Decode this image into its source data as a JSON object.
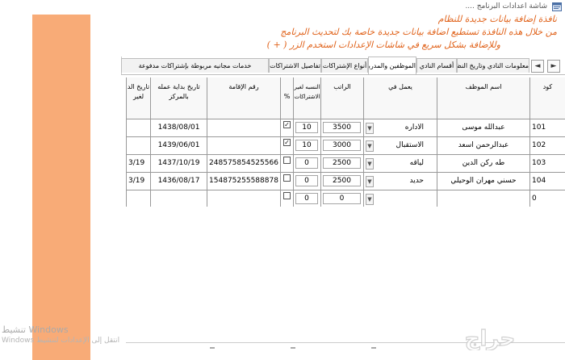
{
  "window": {
    "title": "شاشة اعدادات البرنامج ...."
  },
  "notice": {
    "line1": "نافذة إضافة بيانات جديدة للنظام",
    "line2": "من خلال هذه النافذة تستطيع اضافة بيانات جديدة خاصة بك لتحديث البرنامج",
    "line3": "وللإضافة بشكل سريع في شاشات الإعدادات استخدم الزر ( + )"
  },
  "tabs": [
    {
      "label": "معلومات النادي وتاريخ النظام  والشعار",
      "active": false
    },
    {
      "label": "أقسام النادي",
      "active": false
    },
    {
      "label": "الموظفين والمدربين",
      "active": true
    },
    {
      "label": "أنواع الإشتراكات",
      "active": false
    },
    {
      "label": "تفاصيل الاشتراكات",
      "active": false
    },
    {
      "label": "خدمات مجانيه مربوطة بإشتراكات مدفوعة",
      "active": false
    }
  ],
  "nav": {
    "left_label": "◄",
    "right_label": "►"
  },
  "grid": {
    "headers": {
      "code": "كود",
      "name": "اسم الموظف",
      "works_in": "يعمل في",
      "salary": "الراتب",
      "percent_non_sub": "النسبه لغير الاشتراكات",
      "percent_flag": "%",
      "iqama": "رقم الإقامة",
      "start_date": "تاريخ بداية عمله بالمركز",
      "end_date": "تاريخ الد لغير"
    },
    "rows": [
      {
        "code": "101",
        "name": "عبدالله موسى",
        "works_in": "الاداره",
        "salary": "3500",
        "percent": "10",
        "checked": true,
        "iqama": "",
        "start_date": "1438/08/01",
        "end_date": ""
      },
      {
        "code": "102",
        "name": "عبدالرحمن اسعد",
        "works_in": "الاستقبال",
        "salary": "3000",
        "percent": "10",
        "checked": true,
        "iqama": "",
        "start_date": "1439/06/01",
        "end_date": ""
      },
      {
        "code": "103",
        "name": "طه ركن الدين",
        "works_in": "لياقه",
        "salary": "2500",
        "percent": "0",
        "checked": false,
        "iqama": "248575854525566",
        "start_date": "1437/10/19",
        "end_date": "3/19"
      },
      {
        "code": "104",
        "name": "حسني مهران الوحيلي",
        "works_in": "حديد",
        "salary": "2500",
        "percent": "0",
        "checked": false,
        "iqama": "154875255588878",
        "start_date": "1436/08/17",
        "end_date": "3/19"
      },
      {
        "code": "0",
        "name": "",
        "works_in": "",
        "salary": "0",
        "percent": "0",
        "checked": false,
        "iqama": "",
        "start_date": "",
        "end_date": ""
      }
    ]
  },
  "watermark": {
    "line1": "تنشيط Windows",
    "line2": "انتقل إلى الإعدادات لتنشيط Windows"
  },
  "brand": {
    "logo_text": "حراج"
  },
  "colors": {
    "notice_text": "#e0621a",
    "side_strip": "#f8ab77"
  }
}
